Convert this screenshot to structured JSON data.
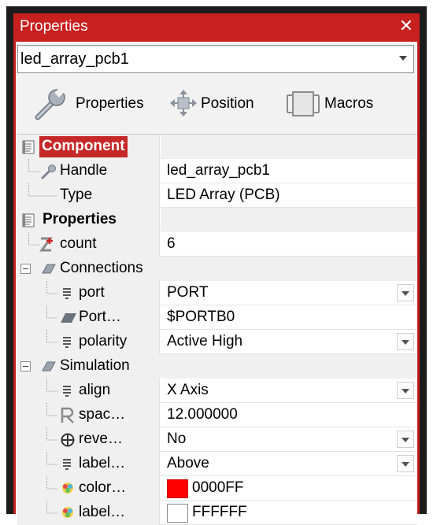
{
  "window": {
    "title": "Properties",
    "close_glyph": "✕"
  },
  "component_select": {
    "value": "led_array_pcb1"
  },
  "toolbar": {
    "properties_label": "Properties",
    "position_label": "Position",
    "macros_label": "Macros"
  },
  "grid": {
    "component_category": "Component",
    "handle_label": "Handle",
    "handle_value": "led_array_pcb1",
    "type_label": "Type",
    "type_value": "LED Array (PCB)",
    "properties_category": "Properties",
    "count_label": "count",
    "count_value": "6",
    "connections_label": "Connections",
    "port_label": "port",
    "port_value": "PORT",
    "portpin_label": "Port…",
    "portpin_value": "$PORTB0",
    "polarity_label": "polarity",
    "polarity_value": "Active High",
    "simulation_label": "Simulation",
    "align_label": "align",
    "align_value": "X Axis",
    "spacing_label": "spac…",
    "spacing_value": "12.000000",
    "reverse_label": "reve…",
    "reverse_value": "No",
    "labelpos_label": "label…",
    "labelpos_value": "Above",
    "color_label": "color…",
    "color_value": "0000FF",
    "labelcolor_label": "label…",
    "labelcolor_value": "FFFFFF"
  },
  "colors": {
    "accent": "#c8201f",
    "color_swatch": "#ff0000",
    "labelcolor_swatch": "#ffffff"
  }
}
